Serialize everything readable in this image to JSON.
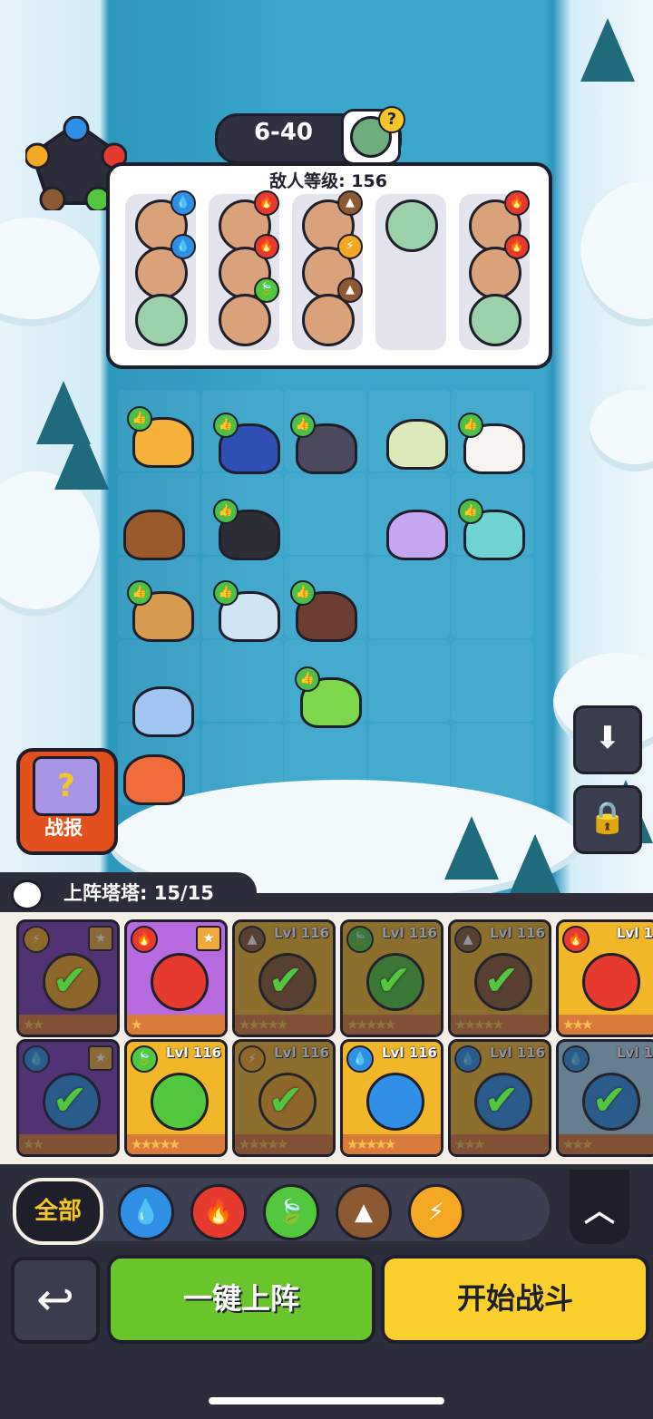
{
  "stage": {
    "label": "6-40",
    "boss_hint": "?"
  },
  "enemy_panel": {
    "level_text": "敌人等级: 156",
    "columns": [
      {
        "enemies": [
          {
            "element": "water"
          },
          {
            "element": "water"
          },
          {
            "element": "none"
          }
        ]
      },
      {
        "enemies": [
          {
            "element": "fire"
          },
          {
            "element": "fire"
          },
          {
            "element": "leaf"
          }
        ]
      },
      {
        "enemies": [
          {
            "element": "earth"
          },
          {
            "element": "lightning"
          },
          {
            "element": "earth"
          }
        ]
      },
      {
        "enemies": [
          {
            "element": "none"
          }
        ]
      },
      {
        "enemies": [
          {
            "element": "fire"
          },
          {
            "element": "fire"
          },
          {
            "element": "none"
          }
        ]
      }
    ]
  },
  "element_colors": {
    "water": "#2f8fe4",
    "fire": "#e63a2e",
    "leaf": "#52c63d",
    "earth": "#8b5a32",
    "lightning": "#f4a823",
    "none": "#9bd1a8"
  },
  "battle_report": {
    "label": "战报",
    "icon": "question-card-icon"
  },
  "side_buttons": [
    {
      "icon": "download-icon"
    },
    {
      "icon": "lock-icon"
    }
  ],
  "roster": {
    "title": "上阵塔塔: 15/15",
    "cards": [
      {
        "row": 0,
        "level": "",
        "element": "lightning",
        "stars": "★★",
        "bg": "#7b3fb4",
        "selected": true,
        "favorite": true
      },
      {
        "row": 0,
        "level": "",
        "element": "fire",
        "stars": "★",
        "bg": "#b56adf",
        "selected": false,
        "favorite": true
      },
      {
        "row": 0,
        "level": "Lvl 116",
        "element": "earth",
        "stars": "★★★★★",
        "bg": "#f2b629",
        "selected": true,
        "favorite": false
      },
      {
        "row": 0,
        "level": "Lvl 116",
        "element": "leaf",
        "stars": "★★★★★",
        "bg": "#f2b629",
        "selected": true,
        "favorite": false
      },
      {
        "row": 0,
        "level": "Lvl 116",
        "element": "earth",
        "stars": "★★★★★",
        "bg": "#f2b629",
        "selected": true,
        "favorite": false
      },
      {
        "row": 0,
        "level": "Lvl 1",
        "element": "fire",
        "stars": "★★★",
        "bg": "#f2b629",
        "selected": false,
        "favorite": false
      },
      {
        "row": 1,
        "level": "",
        "element": "water",
        "stars": "★★",
        "bg": "#7b3fb4",
        "selected": true,
        "favorite": true
      },
      {
        "row": 1,
        "level": "Lvl 116",
        "element": "leaf",
        "stars": "★★★★★",
        "bg": "#f2b629",
        "selected": false,
        "favorite": false
      },
      {
        "row": 1,
        "level": "Lvl 116",
        "element": "lightning",
        "stars": "★★★★★",
        "bg": "#f2b629",
        "selected": true,
        "favorite": false
      },
      {
        "row": 1,
        "level": "Lvl 116",
        "element": "water",
        "stars": "★★★★★",
        "bg": "#f2b629",
        "selected": false,
        "favorite": false
      },
      {
        "row": 1,
        "level": "Lvl 116",
        "element": "water",
        "stars": "★★★",
        "bg": "#f2b629",
        "selected": true,
        "favorite": false
      },
      {
        "row": 1,
        "level": "Lvl 1",
        "element": "water",
        "stars": "★★★",
        "bg": "#a5d6ef",
        "selected": true,
        "favorite": false
      }
    ]
  },
  "filters": {
    "all_label": "全部",
    "items": [
      {
        "name": "water",
        "glyph": "💧"
      },
      {
        "name": "fire",
        "glyph": "🔥"
      },
      {
        "name": "leaf",
        "glyph": "🍃"
      },
      {
        "name": "earth",
        "glyph": "▲"
      },
      {
        "name": "lightning",
        "glyph": "⚡"
      }
    ],
    "collapse_glyph": "︿"
  },
  "actions": {
    "back_glyph": "↩",
    "auto_deploy_label": "一键上阵",
    "start_battle_label": "开始战斗"
  },
  "field_units": [
    {
      "color": "#f4b23a",
      "thumb": true
    },
    {
      "color": "#2f4fb5",
      "thumb": true
    },
    {
      "color": "#4b4a5e",
      "thumb": true
    },
    {
      "color": "#dce9b8",
      "thumb": false
    },
    {
      "color": "#f7f3f0",
      "thumb": true
    },
    {
      "color": "#9a5a2c",
      "thumb": false
    },
    {
      "color": "#2d2d36",
      "thumb": true
    },
    {
      "color": "#c6a6ef",
      "thumb": false
    },
    {
      "color": "#6fd3d2",
      "thumb": true
    },
    {
      "color": "#d79b4f",
      "thumb": true
    },
    {
      "color": "#cfe4f5",
      "thumb": true
    },
    {
      "color": "#6d3f32",
      "thumb": true
    },
    {
      "color": "#9fc5f0",
      "thumb": false
    },
    {
      "color": "#7ed64a",
      "thumb": true
    },
    {
      "color": "#f06c3a",
      "thumb": false
    }
  ]
}
